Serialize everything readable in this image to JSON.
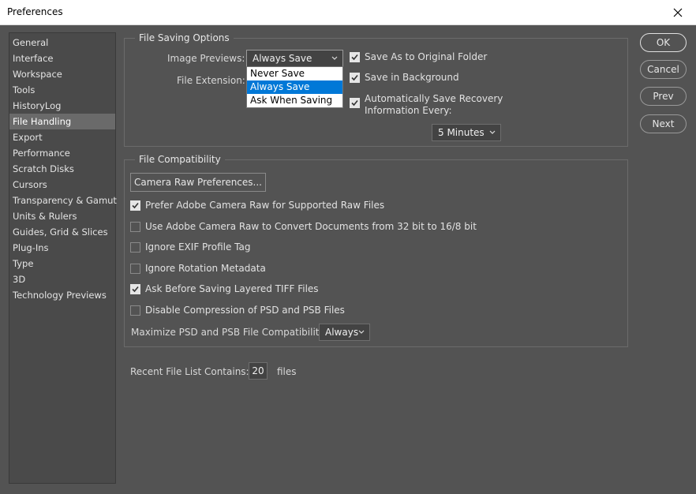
{
  "window": {
    "title": "Preferences"
  },
  "sidebar": {
    "items": [
      {
        "label": "General"
      },
      {
        "label": "Interface"
      },
      {
        "label": "Workspace"
      },
      {
        "label": "Tools"
      },
      {
        "label": "HistoryLog"
      },
      {
        "label": "File Handling"
      },
      {
        "label": "Export"
      },
      {
        "label": "Performance"
      },
      {
        "label": "Scratch Disks"
      },
      {
        "label": "Cursors"
      },
      {
        "label": "Transparency & Gamut"
      },
      {
        "label": "Units & Rulers"
      },
      {
        "label": "Guides, Grid & Slices"
      },
      {
        "label": "Plug-Ins"
      },
      {
        "label": "Type"
      },
      {
        "label": "3D"
      },
      {
        "label": "Technology Previews"
      }
    ],
    "selected": "File Handling"
  },
  "file_saving": {
    "title": "File Saving Options",
    "image_previews_label": "Image Previews:",
    "image_previews_value": "Always Save",
    "image_previews_options": [
      "Never Save",
      "Always Save",
      "Ask When Saving"
    ],
    "file_extension_label": "File Extension:",
    "save_as_original": {
      "label": "Save As to Original Folder",
      "checked": true
    },
    "save_in_background": {
      "label": "Save in Background",
      "checked": true
    },
    "auto_save": {
      "label_line1": "Automatically Save Recovery",
      "label_line2": "Information Every:",
      "checked": true
    },
    "auto_save_interval": "5 Minutes"
  },
  "file_compat": {
    "title": "File Compatibility",
    "camera_raw_button": "Camera Raw Preferences...",
    "options": [
      {
        "label": "Prefer Adobe Camera Raw for Supported Raw Files",
        "checked": true
      },
      {
        "label": "Use Adobe Camera Raw to Convert Documents from 32 bit to 16/8 bit",
        "checked": false
      },
      {
        "label": "Ignore EXIF Profile Tag",
        "checked": false
      },
      {
        "label": "Ignore Rotation Metadata",
        "checked": false
      },
      {
        "label": "Ask Before Saving Layered TIFF Files",
        "checked": true
      },
      {
        "label": "Disable Compression of PSD and PSB Files",
        "checked": false
      }
    ],
    "maximize_label": "Maximize PSD and PSB File Compatibility:",
    "maximize_value": "Always"
  },
  "recent": {
    "label": "Recent File List Contains:",
    "value": "20",
    "suffix": "files"
  },
  "buttons": {
    "ok": "OK",
    "cancel": "Cancel",
    "prev": "Prev",
    "next": "Next"
  }
}
